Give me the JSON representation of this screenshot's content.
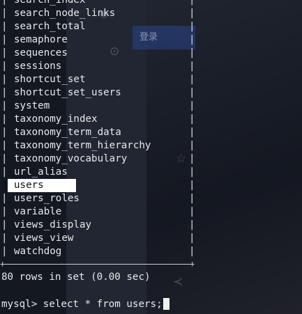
{
  "background": {
    "login_button": "登录"
  },
  "table_rows": [
    "search_index",
    "search_node_links",
    "search_total",
    "semaphore",
    "sequences",
    "sessions",
    "shortcut_set",
    "shortcut_set_users",
    "system",
    "taxonomy_index",
    "taxonomy_term_data",
    "taxonomy_term_hierarchy",
    "taxonomy_vocabulary",
    "url_alias",
    "users",
    "users_roles",
    "variable",
    "views_display",
    "views_view",
    "watchdog"
  ],
  "highlighted_row": "users",
  "result_summary": "80 rows in set (0.00 sec)",
  "prompt": "mysql>",
  "command": "select * from users;",
  "colors": {
    "background": "#141821",
    "text": "#e8e8ea",
    "selection": "#ffffff"
  }
}
